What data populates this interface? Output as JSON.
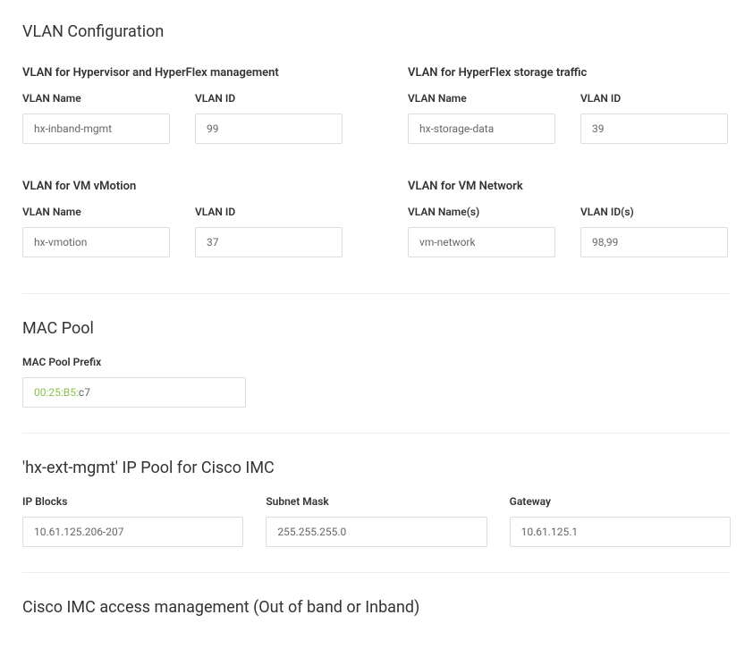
{
  "vlan_config": {
    "title": "VLAN Configuration",
    "management": {
      "title": "VLAN for Hypervisor and HyperFlex management",
      "name_label": "VLAN Name",
      "name_value": "hx-inband-mgmt",
      "id_label": "VLAN ID",
      "id_value": "99"
    },
    "storage": {
      "title": "VLAN for HyperFlex storage traffic",
      "name_label": "VLAN Name",
      "name_value": "hx-storage-data",
      "id_label": "VLAN ID",
      "id_value": "39"
    },
    "vmotion": {
      "title": "VLAN for VM vMotion",
      "name_label": "VLAN Name",
      "name_value": "hx-vmotion",
      "id_label": "VLAN ID",
      "id_value": "37"
    },
    "vm_network": {
      "title": "VLAN for VM Network",
      "name_label": "VLAN Name(s)",
      "name_value": "vm-network",
      "id_label": "VLAN ID(s)",
      "id_value": "98,99"
    }
  },
  "mac_pool": {
    "title": "MAC Pool",
    "prefix_label": "MAC Pool Prefix",
    "fixed_prefix": "00:25:B5:",
    "suffix_value": "c7"
  },
  "ip_pool": {
    "title": "'hx-ext-mgmt' IP Pool for Cisco IMC",
    "blocks_label": "IP Blocks",
    "blocks_value": "10.61.125.206-207",
    "subnet_label": "Subnet Mask",
    "subnet_value": "255.255.255.0",
    "gateway_label": "Gateway",
    "gateway_value": "10.61.125.1"
  },
  "cisco_imc": {
    "title": "Cisco IMC access management (Out of band or Inband)"
  }
}
